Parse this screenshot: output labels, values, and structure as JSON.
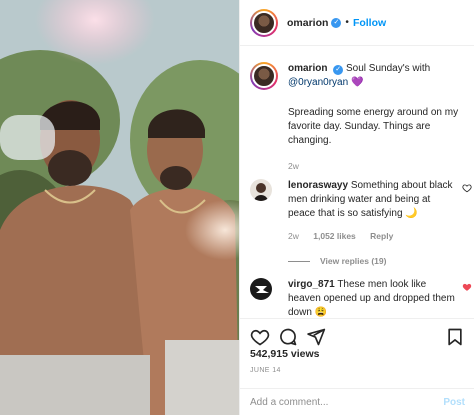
{
  "header": {
    "username": "omarion",
    "separator": "•",
    "follow_label": "Follow"
  },
  "caption": {
    "username": "omarion",
    "text": "Soul Sunday's with",
    "mention": "@0ryan0ryan",
    "emoji": "💜",
    "body": "Spreading some energy around on my favorite day. Sunday. Things are changing.",
    "time": "2w"
  },
  "comments": [
    {
      "username": "lenoraswayy",
      "text": "Something about black men drinking water and being at peace that is so satisfying 🌙",
      "time": "2w",
      "likes": "1,052 likes",
      "reply": "Reply",
      "view_replies": "View replies (19)",
      "liked": false
    },
    {
      "username": "virgo_871",
      "text": "These men look like heaven opened up and dropped them down 😩",
      "liked": true
    }
  ],
  "stats": {
    "likes": "542,915 views",
    "date": "JUNE 14"
  },
  "composer": {
    "placeholder": "Add a comment...",
    "post_label": "Post"
  },
  "icons": {
    "verified": "verified-badge-icon",
    "like": "heart-icon",
    "comment": "comment-icon",
    "share": "paper-plane-icon",
    "save": "bookmark-icon"
  },
  "colors": {
    "link": "#0095f6",
    "liked": "#ed4956",
    "muted": "#8e8e8e",
    "post_disabled": "#b2dffc"
  }
}
